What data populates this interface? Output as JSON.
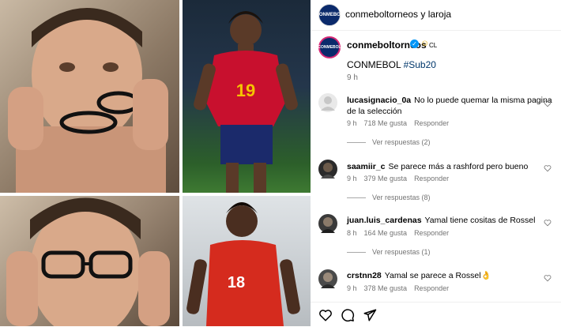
{
  "header": {
    "username": "conmeboltorneos y laroja",
    "logo_text": "CONMEBOL"
  },
  "caption": {
    "username": "conmeboltorneos",
    "badge": "✓",
    "emoji": "☺",
    "suffix": "CL",
    "text": "CONMEBOL ",
    "hashtag": "#Sub20",
    "time": "9 h"
  },
  "comments": [
    {
      "username": "lucasignacio_0a",
      "text": "No lo puede quemar la misma pagina de la selección",
      "time": "9 h",
      "likes": "718 Me gusta",
      "reply": "Responder",
      "view_replies": "Ver respuestas (2)"
    },
    {
      "username": "saamiir_c",
      "text": "Se parece más a rashford pero bueno",
      "time": "9 h",
      "likes": "379 Me gusta",
      "reply": "Responder",
      "view_replies": "Ver respuestas (8)"
    },
    {
      "username": "juan.luis_cardenas",
      "text": "Yamal tiene cositas de Rossel",
      "time": "8 h",
      "likes": "164 Me gusta",
      "reply": "Responder",
      "view_replies": "Ver respuestas (1)"
    },
    {
      "username": "crstnn28",
      "text": "Yamal se parece a Rossel👌",
      "time": "9 h",
      "likes": "378 Me gusta",
      "reply": "Responder"
    }
  ],
  "player_numbers": {
    "top": "19",
    "bottom": "18"
  },
  "colors": {
    "link": "#00376b",
    "muted": "#737373",
    "spain_red": "#c8102e",
    "chile_red": "#d52b1e"
  }
}
